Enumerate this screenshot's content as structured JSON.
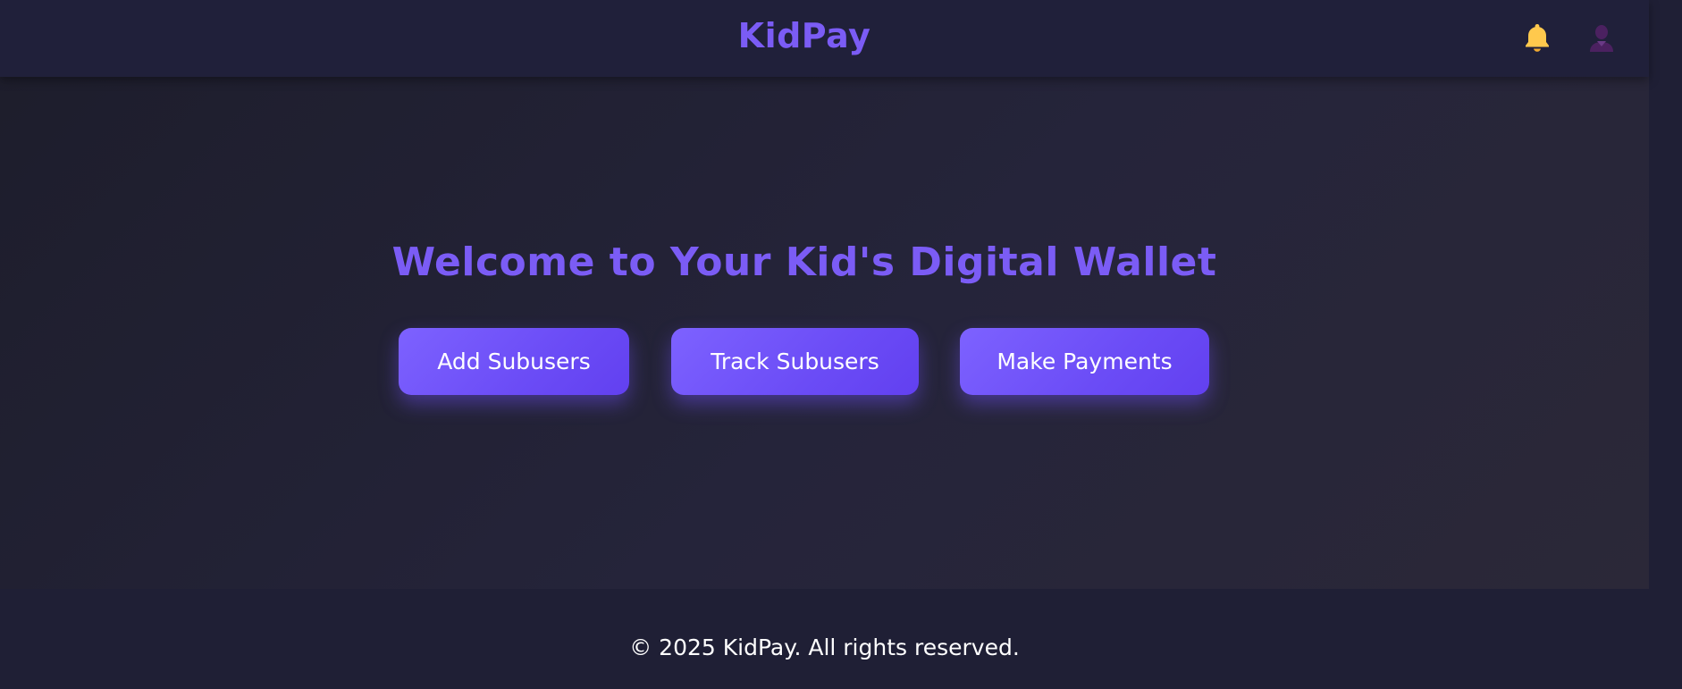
{
  "header": {
    "brand": "KidPay",
    "icons": [
      "bell-icon",
      "user-icon"
    ]
  },
  "hero": {
    "title": "Welcome to Your Kid's Digital Wallet"
  },
  "actions": {
    "add_label": "Add Subusers",
    "track_label": "Track Subusers",
    "pay_label": "Make Payments"
  },
  "footer": {
    "text": "© 2025 KidPay. All rights reserved."
  },
  "colors": {
    "accent": "#7b5cf5",
    "header_bg": "#20203a",
    "bell": "#ffc94d",
    "user_icon": "#5a2a6a"
  }
}
